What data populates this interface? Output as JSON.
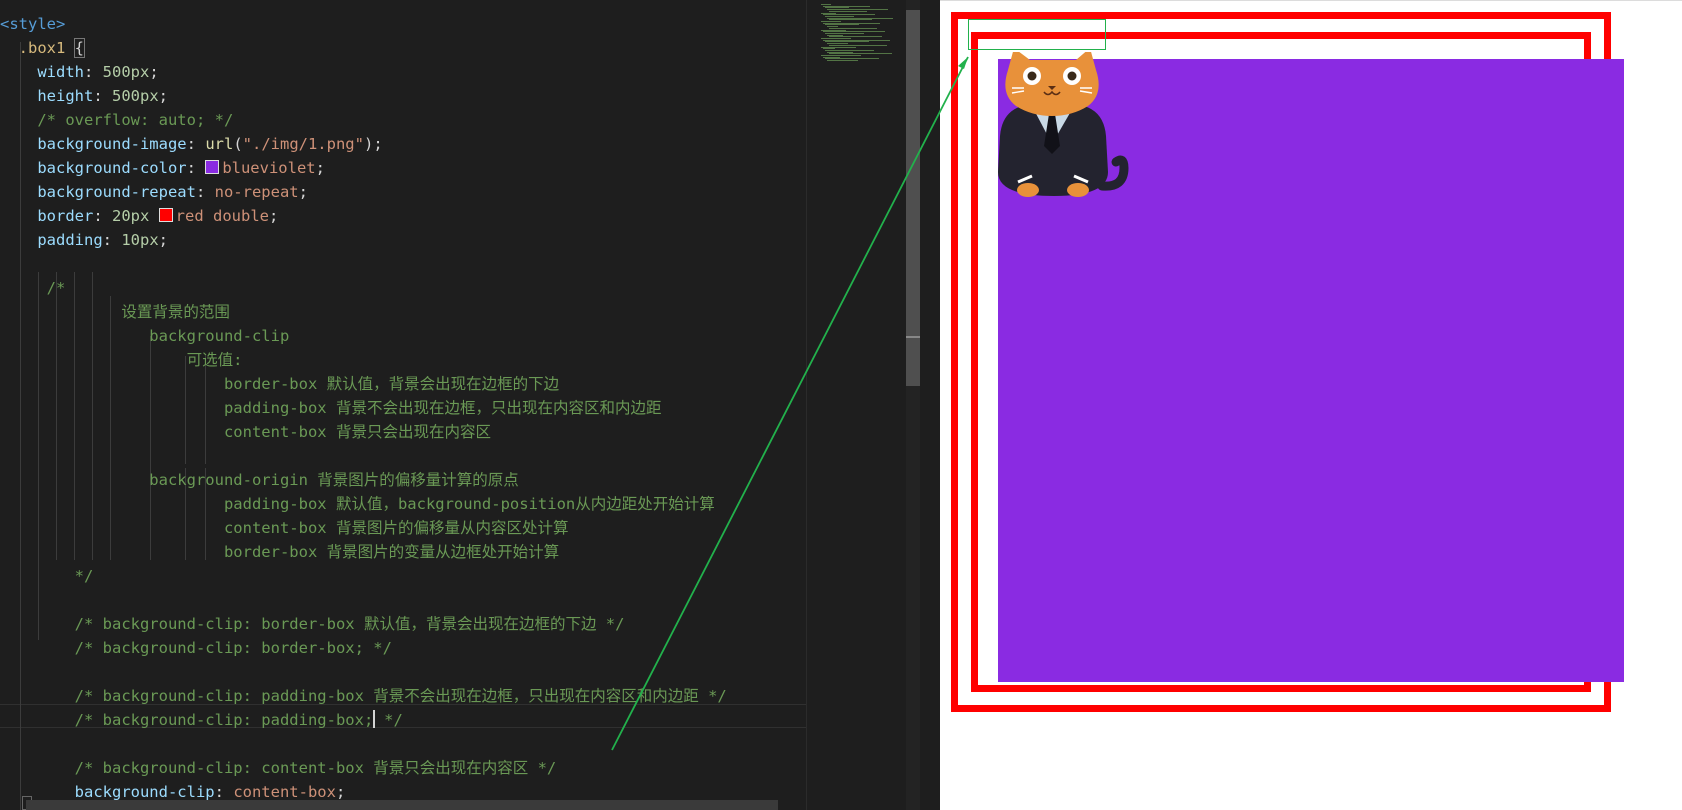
{
  "editor": {
    "lines": [
      [
        {
          "t": "<style>",
          "c": "tk-tag"
        }
      ],
      [
        {
          "t": "  .box1 ",
          "c": "tk-sel"
        },
        {
          "t": "{",
          "c": "tk-brace"
        }
      ],
      [
        {
          "t": "    "
        },
        {
          "t": "width",
          "c": "tk-prop"
        },
        {
          "t": ": ",
          "c": "tk-punc"
        },
        {
          "t": "500px",
          "c": "tk-num"
        },
        {
          "t": ";",
          "c": "tk-punc"
        }
      ],
      [
        {
          "t": "    "
        },
        {
          "t": "height",
          "c": "tk-prop"
        },
        {
          "t": ": ",
          "c": "tk-punc"
        },
        {
          "t": "500px",
          "c": "tk-num"
        },
        {
          "t": ";",
          "c": "tk-punc"
        }
      ],
      [
        {
          "t": "    /* overflow: auto; */",
          "c": "tk-cmt"
        }
      ],
      [
        {
          "t": "    "
        },
        {
          "t": "background-image",
          "c": "tk-prop"
        },
        {
          "t": ": ",
          "c": "tk-punc"
        },
        {
          "t": "url",
          "c": "tk-func"
        },
        {
          "t": "(",
          "c": "tk-punc"
        },
        {
          "t": "\"./img/1.png\"",
          "c": "tk-val"
        },
        {
          "t": ");",
          "c": "tk-punc"
        }
      ],
      [
        {
          "t": "    "
        },
        {
          "t": "background-color",
          "c": "tk-prop"
        },
        {
          "t": ": ",
          "c": "tk-punc"
        },
        {
          "swatch": "#8a2be2"
        },
        {
          "t": "blueviolet",
          "c": "tk-val"
        },
        {
          "t": ";",
          "c": "tk-punc"
        }
      ],
      [
        {
          "t": "    "
        },
        {
          "t": "background-repeat",
          "c": "tk-prop"
        },
        {
          "t": ": ",
          "c": "tk-punc"
        },
        {
          "t": "no-repeat",
          "c": "tk-val"
        },
        {
          "t": ";",
          "c": "tk-punc"
        }
      ],
      [
        {
          "t": "    "
        },
        {
          "t": "border",
          "c": "tk-prop"
        },
        {
          "t": ": ",
          "c": "tk-punc"
        },
        {
          "t": "20px ",
          "c": "tk-num"
        },
        {
          "swatch": "#ff0000"
        },
        {
          "t": "red double",
          "c": "tk-val"
        },
        {
          "t": ";",
          "c": "tk-punc"
        }
      ],
      [
        {
          "t": "    "
        },
        {
          "t": "padding",
          "c": "tk-prop"
        },
        {
          "t": ": ",
          "c": "tk-punc"
        },
        {
          "t": "10px",
          "c": "tk-num"
        },
        {
          "t": ";",
          "c": "tk-punc"
        }
      ],
      [
        {
          "t": ""
        }
      ],
      [
        {
          "t": "     /*",
          "c": "tk-cmt"
        }
      ],
      [
        {
          "t": "             设置背景的范围",
          "c": "tk-cmt"
        }
      ],
      [
        {
          "t": "                background-clip",
          "c": "tk-cmt"
        }
      ],
      [
        {
          "t": "                    可选值:",
          "c": "tk-cmt"
        }
      ],
      [
        {
          "t": "                        border-box 默认值，背景会出现在边框的下边",
          "c": "tk-cmt"
        }
      ],
      [
        {
          "t": "                        padding-box 背景不会出现在边框，只出现在内容区和内边距",
          "c": "tk-cmt"
        }
      ],
      [
        {
          "t": "                        content-box 背景只会出现在内容区",
          "c": "tk-cmt"
        }
      ],
      [
        {
          "t": ""
        }
      ],
      [
        {
          "t": "                background-origin 背景图片的偏移量计算的原点",
          "c": "tk-cmt"
        }
      ],
      [
        {
          "t": "                        padding-box 默认值，background-position从内边距处开始计算",
          "c": "tk-cmt"
        }
      ],
      [
        {
          "t": "                        content-box 背景图片的偏移量从内容区处计算",
          "c": "tk-cmt"
        }
      ],
      [
        {
          "t": "                        border-box 背景图片的变量从边框处开始计算",
          "c": "tk-cmt"
        }
      ],
      [
        {
          "t": "        */",
          "c": "tk-cmt"
        }
      ],
      [
        {
          "t": ""
        }
      ],
      [
        {
          "t": "        /* background-clip: border-box 默认值，背景会出现在边框的下边 */",
          "c": "tk-cmt"
        }
      ],
      [
        {
          "t": "        /* background-clip: border-box; */",
          "c": "tk-cmt"
        }
      ],
      [
        {
          "t": ""
        }
      ],
      [
        {
          "t": "        /* background-clip: padding-box 背景不会出现在边框，只出现在内容区和内边距 */",
          "c": "tk-cmt"
        }
      ],
      [
        {
          "t": "        /* background-clip: padding-box;",
          "c": "tk-cmt"
        },
        {
          "caret": true
        },
        {
          "t": " */",
          "c": "tk-cmt"
        }
      ],
      [
        {
          "t": ""
        }
      ],
      [
        {
          "t": "        /* background-clip: content-box 背景只会出现在内容区 */",
          "c": "tk-cmt"
        }
      ],
      [
        {
          "t": "        "
        },
        {
          "t": "background-clip",
          "c": "tk-prop"
        },
        {
          "t": ": ",
          "c": "tk-punc"
        },
        {
          "t": "content-box",
          "c": "tk-val"
        },
        {
          "t": ";",
          "c": "tk-punc"
        }
      ]
    ]
  },
  "preview": {
    "border_color": "#ff0000",
    "background_color": "#8a2be2",
    "annotation_color": "#22b14c",
    "image": "cat-in-suit-illustration"
  }
}
